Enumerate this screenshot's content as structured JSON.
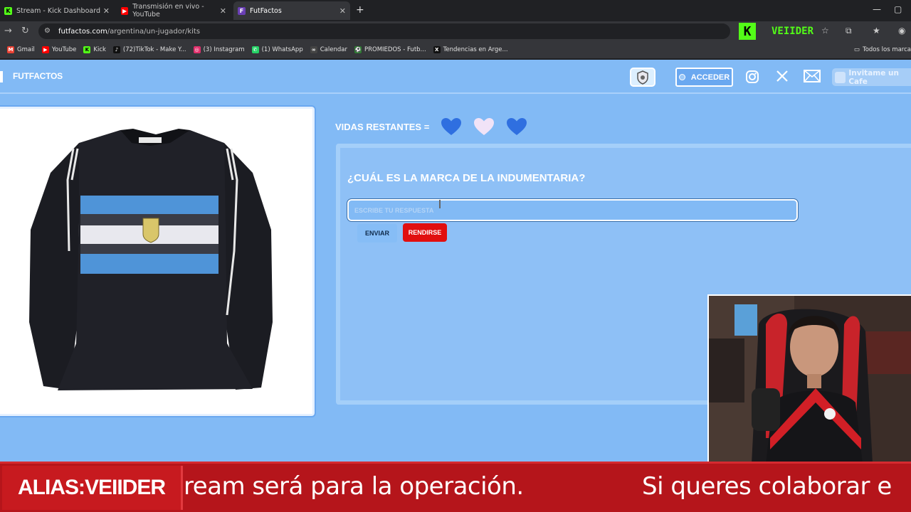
{
  "browser": {
    "tabs": [
      {
        "title": "Stream - Kick Dashboard",
        "icon": "kick-icon"
      },
      {
        "title": "Transmisión en vivo - YouTube",
        "icon": "youtube-icon"
      },
      {
        "title": "FutFactos",
        "icon": "futfactos-icon",
        "active": true
      }
    ],
    "url_domain": "futfactos.com",
    "url_path": "/argentina/un-jugador/kits",
    "extension_label": "VEIIDER",
    "bookmarks": [
      {
        "label": "Gmail",
        "color": "#ea4335"
      },
      {
        "label": "YouTube",
        "color": "#ff0000"
      },
      {
        "label": "Kick",
        "color": "#53fc18"
      },
      {
        "label": "(72)TikTok - Make Y...",
        "color": "#000000"
      },
      {
        "label": "(3) Instagram",
        "color": "#e1306c"
      },
      {
        "label": "(1) WhatsApp",
        "color": "#25d366"
      },
      {
        "label": "Calendar",
        "color": "#ffffff"
      },
      {
        "label": "PROMIEDOS - Futb...",
        "color": "#2e7d32"
      },
      {
        "label": "Tendencias en Arge...",
        "color": "#000000"
      }
    ],
    "all_bookmarks_label": "Todos los marca"
  },
  "site": {
    "brand": "FUTFACTOS",
    "login_label": "ACCEDER",
    "coffee_label": "Invitame un Cafe"
  },
  "game": {
    "lives_label": "VIDAS RESTANTES =",
    "lives": [
      {
        "state": "full",
        "color": "#2f6fe0"
      },
      {
        "state": "lost",
        "color": "#f1e3f7"
      },
      {
        "state": "full",
        "color": "#2f6fe0"
      }
    ],
    "question": "¿CUÁL ES LA MARCA DE LA INDUMENTARIA?",
    "answer_placeholder": "ESCRIBE TU RESPUESTA",
    "answer_value": "",
    "submit_label": "ENVIAR",
    "give_up_label": "RENDIRSE"
  },
  "ticker": {
    "alias": "ALIAS:VEIIDER",
    "message_left": "ream será para la operación.",
    "message_right": "Si queres colaborar e"
  },
  "colors": {
    "page_bg": "#82baf5",
    "ticker_bg": "#b5151b",
    "give_up_bg": "#e10f0f",
    "kick_green": "#53fc18"
  }
}
